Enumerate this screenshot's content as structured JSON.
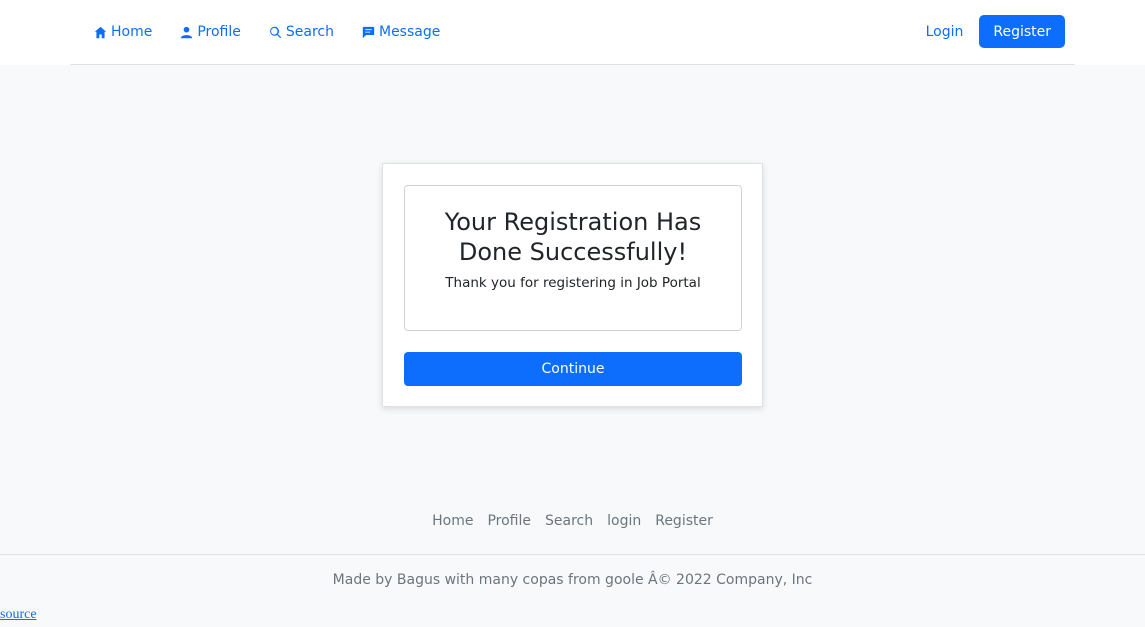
{
  "nav": {
    "items": [
      {
        "label": "Home",
        "icon": "home-icon"
      },
      {
        "label": "Profile",
        "icon": "user-icon"
      },
      {
        "label": "Search",
        "icon": "search-icon"
      },
      {
        "label": "Message",
        "icon": "message-icon"
      }
    ],
    "login_label": "Login",
    "register_label": "Register"
  },
  "card": {
    "title": "Your Registration Has Done Successfully!",
    "subtitle": "Thank you for registering in Job Portal",
    "continue_label": "Continue"
  },
  "footer": {
    "links": [
      "Home",
      "Profile",
      "Search",
      "login",
      "Register"
    ],
    "copyright": "Made by Bagus with many copas from goole Â© 2022 Company, Inc",
    "source_label": "source"
  },
  "colors": {
    "accent": "#0d6efd",
    "muted": "#6c757d",
    "background": "#f8f9fa"
  }
}
